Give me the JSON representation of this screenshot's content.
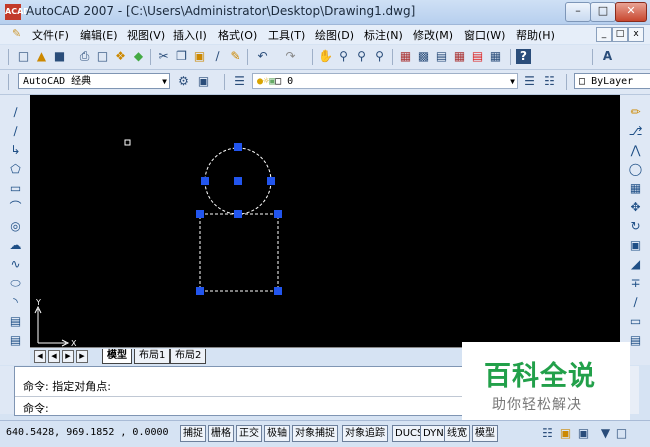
{
  "window": {
    "title": "AutoCAD 2007 - [C:\\Users\\Administrator\\Desktop\\Drawing1.dwg]",
    "app_icon_text": "ACAD"
  },
  "menu": {
    "items": [
      "文件(F)",
      "编辑(E)",
      "视图(V)",
      "插入(I)",
      "格式(O)",
      "工具(T)",
      "绘图(D)",
      "标注(N)",
      "修改(M)",
      "窗口(W)",
      "帮助(H)"
    ]
  },
  "toolbar": {
    "workspace": "AutoCAD 经典",
    "layer": "0",
    "color": "ByLayer"
  },
  "tabs": {
    "items": [
      "模型",
      "布局1",
      "布局2"
    ],
    "active": "模型"
  },
  "command": {
    "line1": "命令: 指定对角点:",
    "line2": "命令:"
  },
  "status": {
    "coords": "640.5428,  969.1852 ,  0.0000",
    "toggles": [
      "捕捉",
      "栅格",
      "正交",
      "极轴",
      "对象捕捉",
      "对象追踪",
      "DUCS",
      "DYN",
      "线宽",
      "模型"
    ]
  },
  "ucs": {
    "x_label": "X",
    "y_label": "Y"
  },
  "watermark": {
    "title": "百科全说",
    "subtitle": "助你轻松解决"
  },
  "colors": {
    "canvas": "#000000",
    "grip": "#2255ee",
    "entity": "#ffffff"
  },
  "icons": {
    "top_toolbar": [
      "new-icon",
      "open-icon",
      "save-icon",
      "plot-icon",
      "preview-icon",
      "publish-icon",
      "3d-icon",
      "cut-icon",
      "copy-icon",
      "paste-icon",
      "match-icon",
      "brush-icon",
      "undo-icon",
      "redo-icon",
      "pan-icon",
      "zoom-icon",
      "zoom-window-icon",
      "zoom-previous-icon",
      "properties-icon",
      "design-center-icon",
      "tool-palette-icon",
      "sheet-set-icon",
      "markup-icon",
      "calculator-icon",
      "help-icon",
      "text-style-icon"
    ],
    "draw": [
      "line-icon",
      "construction-line-icon",
      "polyline-icon",
      "polygon-icon",
      "rectangle-icon",
      "arc-icon",
      "circle-icon",
      "revision-cloud-icon",
      "spline-icon",
      "ellipse-icon",
      "ellipse-arc-icon",
      "insert-block-icon",
      "make-block-icon"
    ],
    "modify": [
      "erase-icon",
      "copy-object-icon",
      "mirror-icon",
      "offset-icon",
      "array-icon",
      "move-icon",
      "rotate-icon",
      "scale-icon",
      "stretch-icon",
      "trim-icon",
      "extend-icon",
      "break-icon",
      "join-icon"
    ]
  }
}
